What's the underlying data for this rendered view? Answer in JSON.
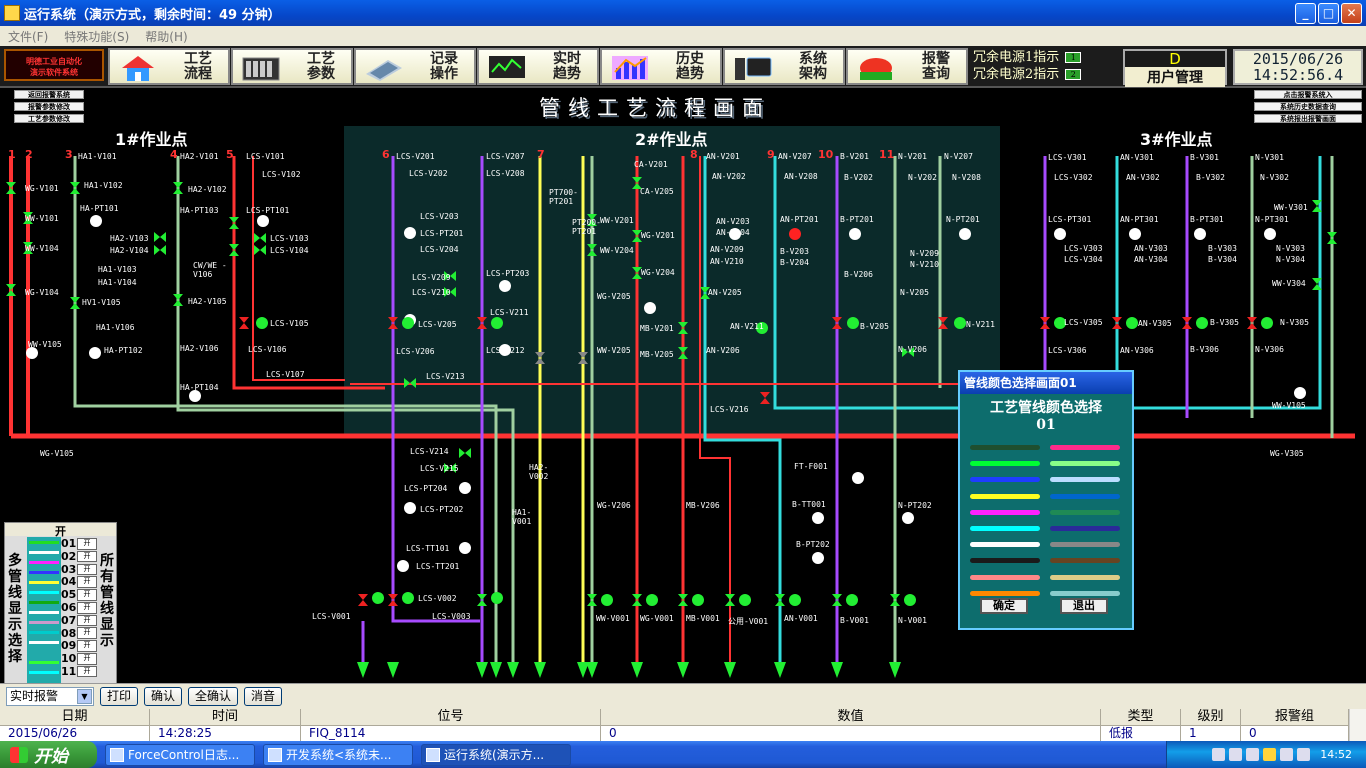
{
  "window": {
    "title": "运行系统（演示方式，剩余时间：49 分钟）",
    "min": "_",
    "max": "□",
    "close": "✕"
  },
  "menu": [
    "文件(F)",
    "特殊功能(S)",
    "帮助(H)"
  ],
  "logo": {
    "line1": "明德工业自动化",
    "line2": "演示软件系统"
  },
  "nav": [
    {
      "label": "工艺流程",
      "icon": "house-icon"
    },
    {
      "label": "工艺参数",
      "icon": "rack-icon"
    },
    {
      "label": "记录操作",
      "icon": "keyboard-icon"
    },
    {
      "label": "实时趋势",
      "icon": "monitor-trend-icon"
    },
    {
      "label": "历史趋势",
      "icon": "bar-chart-icon"
    },
    {
      "label": "系统架构",
      "icon": "server-icon"
    },
    {
      "label": "报警查询",
      "icon": "alarm-light-icon"
    }
  ],
  "redundancy": [
    {
      "label": "冗余电源1指示",
      "value": "1"
    },
    {
      "label": "冗余电源2指示",
      "value": "2"
    }
  ],
  "user": {
    "level": "D",
    "label": "用户管理"
  },
  "datetime": {
    "date": "2015/06/26",
    "time": "14:52:56.4"
  },
  "side_left": [
    "返回报警系统",
    "报警参数修改",
    "工艺参数修改"
  ],
  "side_right": [
    "点击报警系统入",
    "系统历史数据查询",
    "系统报出报警画面"
  ],
  "page_title": "管线工艺流程画面",
  "zones": [
    "1#作业点",
    "2#作业点",
    "3#作业点"
  ],
  "line_numbers": [
    "1",
    "2",
    "3",
    "4",
    "5",
    "6",
    "7",
    "8",
    "9",
    "10",
    "11"
  ],
  "labels": {
    "ha1v101": "HA1-V101",
    "ha1v102": "HA1-V102",
    "hapt101": "HA-PT101",
    "ha2v103": "HA2-V103",
    "ha2v104": "HA2-V104",
    "ha1v103": "HA1-V103",
    "ha1v104": "HA1-V104",
    "hv1v105": "HV1-V105",
    "ha1v106": "HA1-V106",
    "hapt102": "HA-PT102",
    "wgv101": "WG-V101",
    "wwv101": "WW-V101",
    "wwv104": "WW-V104",
    "wgv104": "WG-V104",
    "wwv105": "WW-V105",
    "wgv105": "WG-V105",
    "ha2v101": "HA2-V101",
    "ha2v102": "HA2-V102",
    "hapt103": "HA-PT103",
    "cwv106": "CW/WE -V106",
    "ha2v105": "HA2-V105",
    "ha2v106": "HA2-V106",
    "hapt104": "HA-PT104",
    "lcsv101": "LCS-V101",
    "lcsv102": "LCS-V102",
    "lcspt101": "LCS-PT101",
    "lcsv103": "LCS-V103",
    "lcsv104": "LCS-V104",
    "lcsv105": "LCS-V105",
    "lcsv106": "LCS-V106",
    "lcsv107": "LCS-V107",
    "lcsv201": "LCS-V201",
    "lcsv202": "LCS-V202",
    "lcsv203": "LCS-V203",
    "lcspt201": "LCS-PT201",
    "lcsv204": "LCS-V204",
    "lcsv209": "LCS-V209",
    "lcsv210": "LCS-V210",
    "lcsv205": "LCS-V205",
    "lcsv206": "LCS-V206",
    "lcsv213": "LCS-V213",
    "lcsv214": "LCS-V214",
    "lcsv215": "LCS-V215",
    "lcspt204": "LCS-PT204",
    "lcspt202": "LCS-PT202",
    "lcstt101": "LCS-TT101",
    "lcstt201": "LCS-TT201",
    "lcsv002": "LCS-V002",
    "lcsv001": "LCS-V001",
    "lcsv003": "LCS-V003",
    "lcsv207": "LCS-V207",
    "lcsv208": "LCS-V208",
    "lcspt203": "LCS-PT203",
    "lcsv211": "LCS-V211",
    "lcsv212": "LCS-V212",
    "pt1": "PT700-PT201",
    "pt2": "PT200-PT201",
    "wwv201": "WW-V201",
    "wwv204": "WW-V204",
    "wwv205": "WW-V205",
    "wgv201": "WG-V201",
    "wgv204": "WG-V204",
    "wgv205": "WG-V205",
    "wgv206": "WG-V206",
    "wgv001": "WG-V001",
    "wwv001": "WW-V001",
    "cav201": "CA-V201",
    "cav205": "CA-V205",
    "mbv201": "MB-V201",
    "mbv205": "MB-V205",
    "mbv206": "MB-V206",
    "mbv001": "MB-V001",
    "anv201": "AN-V201",
    "anv202": "AN-V202",
    "anv203": "AN-V203",
    "anv204": "AN-V204",
    "anv209": "AN-V209",
    "anv210": "AN-V210",
    "anv205": "AN-V205",
    "anv206": "AN-V206",
    "anv207": "AN-V207",
    "anv208": "AN-V208",
    "anpt201": "AN-PT201",
    "anv211": "AN-V211",
    "anv001": "AN-V001",
    "gy001": "公用-V001",
    "bv201": "B-V201",
    "bv202": "B-V202",
    "bpt201": "B-PT201",
    "bv203": "B-V203",
    "bv204": "B-V204",
    "bv206": "B-V206",
    "bv205": "B-V205",
    "ftf001": "FT-F001",
    "btt001": "B-TT001",
    "bpt202": "B-PT202",
    "bv001": "B-V001",
    "nv201": "N-V201",
    "nv202": "N-V202",
    "nv207": "N-V207",
    "nv208": "N-V208",
    "npt201": "N-PT201",
    "nv209": "N-V209",
    "nv210": "N-V210",
    "nv205": "N-V205",
    "nv211": "N-V211",
    "nv206": "N-V206",
    "npt202": "N-PT202",
    "nv001": "N-V001",
    "lcsv216": "LCS-V216",
    "lcsv301": "LCS-V301",
    "lcsv302": "LCS-V302",
    "lcspt301": "LCS-PT301",
    "lcsv303": "LCS-V303",
    "lcsv304": "LCS-V304",
    "lcsv305": "LCS-V305",
    "lcsv306": "LCS-V306",
    "anv301": "AN-V301",
    "anv302": "AN-V302",
    "anpt301": "AN-PT301",
    "anv303": "AN-V303",
    "anv304": "AN-V304",
    "anv305": "AN-V305",
    "anv306": "AN-V306",
    "bv301": "B-V301",
    "bv302": "B-V302",
    "bpt301": "B-PT301",
    "bv303": "B-V303",
    "bv304": "B-V304",
    "bv305": "B-V305",
    "bv306": "B-V306",
    "nv301": "N-V301",
    "nv302": "N-V302",
    "npt301": "N-PT301",
    "nv303": "N-V303",
    "nv304": "N-V304",
    "nv305": "N-V305",
    "nv306": "N-V306",
    "wwv301": "WW-V301",
    "wwv304": "WW-V304",
    "wwv105b": "WW-V105",
    "wgv305": "WG-V305",
    "ha1v001": "HA1-V001",
    "ha2v002": "HA2-V002"
  },
  "multisel": {
    "title": "开",
    "left": "多管线显示选择",
    "right": "所有管线显示",
    "numbers": [
      "01",
      "02",
      "03",
      "04",
      "05",
      "06",
      "07",
      "08",
      "09",
      "10",
      "11"
    ],
    "btn": "开"
  },
  "color_dialog": {
    "title": "管线颜色选择画面01",
    "heading": "工艺管线颜色选择",
    "number": "01",
    "left_colors": [
      "#1f4f2f",
      "#00ff33",
      "#1e3dff",
      "#ffff22",
      "#ff22ff",
      "#00ffff",
      "#ffffff",
      "#1a1a1a",
      "#ff8888",
      "#ff8800"
    ],
    "right_colors": [
      "#ff2b8a",
      "#88ff88",
      "#bbddff",
      "#0066cc",
      "#1f8a55",
      "#2a2a99",
      "#888888",
      "#664422",
      "#ddcc88",
      "#88cccc"
    ],
    "ok": "确定",
    "exit": "退出"
  },
  "alarm_toolbar": {
    "select": "实时报警",
    "print": "打印",
    "confirm": "确认",
    "confirm_all": "全确认",
    "mute": "消音"
  },
  "alarm_table": {
    "columns": [
      "日期",
      "时间",
      "位号",
      "数值",
      "类型",
      "级别",
      "报警组"
    ],
    "rows": [
      [
        "2015/06/26",
        "14:28:25",
        "FIQ_8114",
        "0",
        "低报",
        "1",
        "0"
      ]
    ]
  },
  "taskbar": {
    "start": "开始",
    "tasks": [
      "ForceControl日志...",
      "开发系统<系统未...",
      "运行系统(演示方..."
    ],
    "clock": "14:52"
  },
  "colors": {
    "bg": "#000000",
    "zone2": "#0b2a2a",
    "pipe_red": "#ff3333",
    "pipe_purple": "#a74bff",
    "pipe_cyan": "#33dddd",
    "pipe_yellow": "#ffff55",
    "pipe_green": "#a0d0a0",
    "valve_open": "#22ee33",
    "valve_closed": "#ee2222"
  }
}
